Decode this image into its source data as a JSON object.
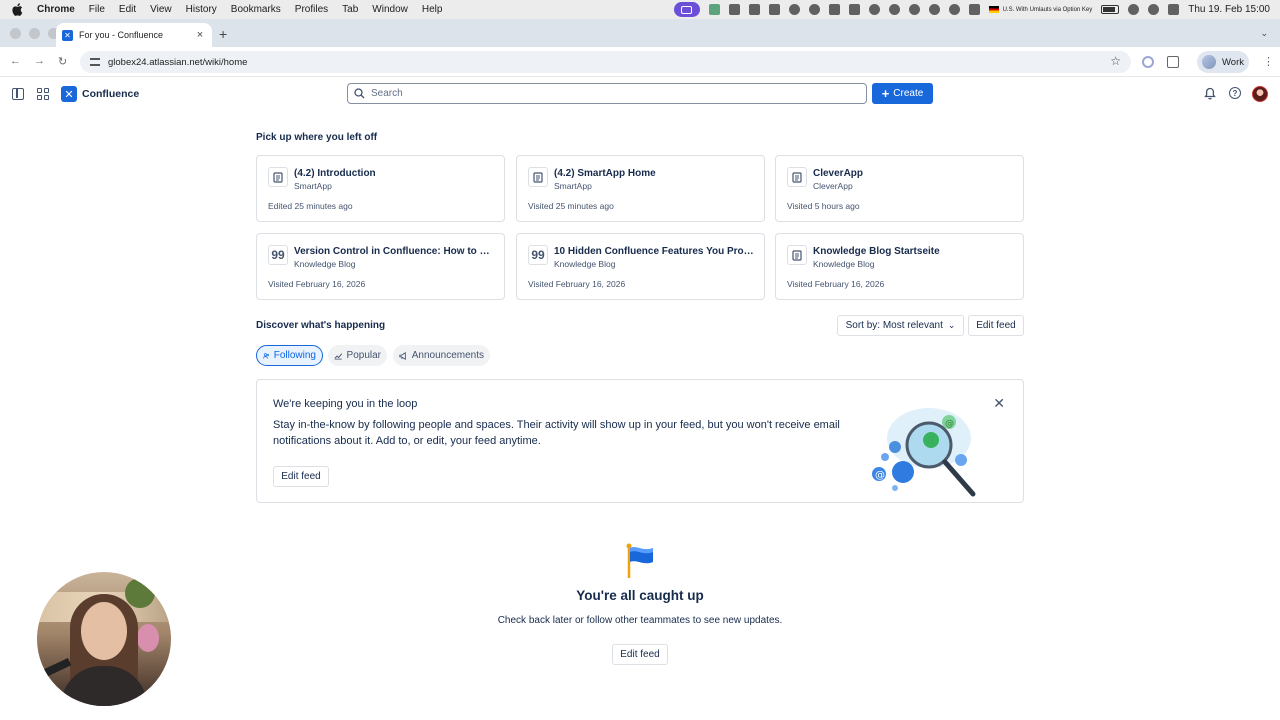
{
  "menubar": {
    "app": "Chrome",
    "items": [
      "File",
      "Edit",
      "View",
      "History",
      "Bookmarks",
      "Profiles",
      "Tab",
      "Window",
      "Help"
    ],
    "keyboard": "U.S. With Umlauts via Option Key",
    "clock": "Thu 19. Feb  15:00"
  },
  "browser": {
    "tab_title": "For you - Confluence",
    "url": "globex24.atlassian.net/wiki/home",
    "profile_label": "Work"
  },
  "header": {
    "product": "Confluence",
    "search_placeholder": "Search",
    "create_label": "Create"
  },
  "recent": {
    "title": "Pick up where you left off",
    "cards": [
      {
        "icon": "page-icon",
        "title": "(4.2) Introduction",
        "space": "SmartApp",
        "meta": "Edited 25 minutes ago"
      },
      {
        "icon": "page-icon",
        "title": "(4.2) SmartApp Home",
        "space": "SmartApp",
        "meta": "Visited 25 minutes ago"
      },
      {
        "icon": "page-icon",
        "title": "CleverApp",
        "space": "CleverApp",
        "meta": "Visited 5 hours ago"
      },
      {
        "icon": "quote-icon",
        "title": "Version Control in Confluence: How to M...",
        "space": "Knowledge Blog",
        "meta": "Visited February 16, 2026"
      },
      {
        "icon": "quote-icon",
        "title": "10 Hidden Confluence Features You Prob...",
        "space": "Knowledge Blog",
        "meta": "Visited February 16, 2026"
      },
      {
        "icon": "page-icon",
        "title": "Knowledge Blog Startseite",
        "space": "Knowledge Blog",
        "meta": "Visited February 16, 2026"
      }
    ]
  },
  "discover": {
    "title": "Discover what's happening",
    "sort_label": "Sort by: Most relevant",
    "edit_feed_label": "Edit feed",
    "filters": [
      "Following",
      "Popular",
      "Announcements"
    ],
    "active_filter": "Following"
  },
  "banner": {
    "title": "We're keeping you in the loop",
    "description": "Stay in-the-know by following people and spaces. Their activity will show up in your feed, but you won't receive email notifications about it. Add to, or edit, your feed anytime.",
    "button_label": "Edit feed"
  },
  "empty_state": {
    "title": "You're all caught up",
    "description": "Check back later or follow other teammates to see new updates.",
    "button_label": "Edit feed"
  },
  "colors": {
    "brand": "#1868db",
    "text": "#172b4d",
    "subtle_text": "#44546f",
    "border": "#dcdfe4"
  }
}
